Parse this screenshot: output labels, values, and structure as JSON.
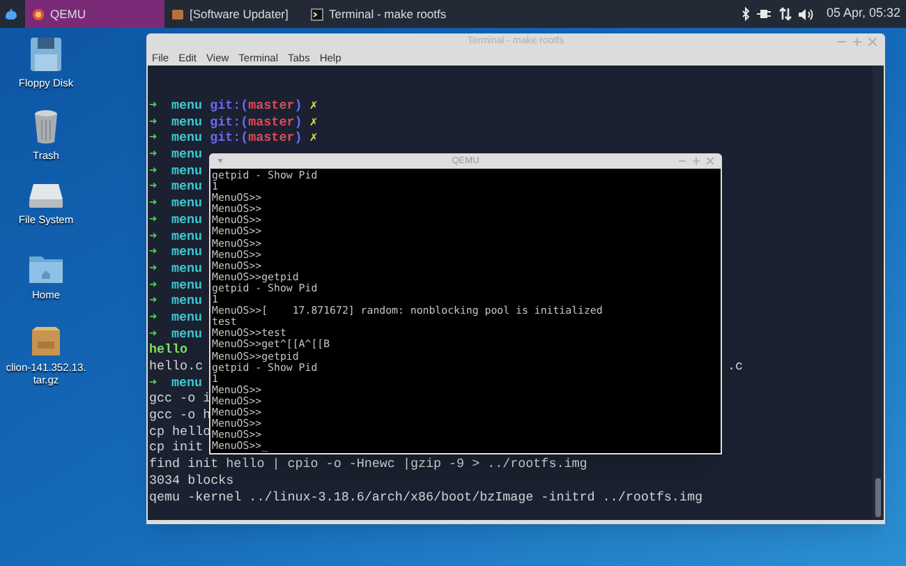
{
  "top_panel": {
    "tasks": [
      {
        "label": "QEMU",
        "kind": "qemu",
        "selected": true
      },
      {
        "label": "[Software Updater]",
        "kind": "updater",
        "selected": false
      },
      {
        "label": "Terminal - make rootfs",
        "kind": "terminal",
        "selected": false
      }
    ],
    "clock": "05 Apr, 05:32"
  },
  "desktop_icons": [
    {
      "label": "Floppy Disk",
      "kind": "floppy"
    },
    {
      "label": "Trash",
      "kind": "trash"
    },
    {
      "label": "File System",
      "kind": "drive"
    },
    {
      "label": "Home",
      "kind": "folder"
    },
    {
      "label": "clion-141.352.13.tar.gz",
      "kind": "archive"
    }
  ],
  "terminal_window": {
    "title": "Terminal - make rootfs",
    "menu": [
      "File",
      "Edit",
      "View",
      "Terminal",
      "Tabs",
      "Help"
    ],
    "lines": [
      {
        "kind": "prompt",
        "arrow": "➜",
        "dir": "menu",
        "git": "git:(",
        "branch": "master",
        "git_end": ")",
        "dirty": "✗"
      },
      {
        "kind": "prompt",
        "arrow": "➜",
        "dir": "menu",
        "git": "git:(",
        "branch": "master",
        "git_end": ")",
        "dirty": "✗"
      },
      {
        "kind": "prompt",
        "arrow": "➜",
        "dir": "menu",
        "git": "git:(",
        "branch": "master",
        "git_end": ")",
        "dirty": "✗"
      },
      {
        "kind": "prompt",
        "arrow": "➜",
        "dir": "menu"
      },
      {
        "kind": "prompt",
        "arrow": "➜",
        "dir": "menu"
      },
      {
        "kind": "prompt",
        "arrow": "➜",
        "dir": "menu"
      },
      {
        "kind": "prompt",
        "arrow": "➜",
        "dir": "menu"
      },
      {
        "kind": "prompt",
        "arrow": "➜",
        "dir": "menu"
      },
      {
        "kind": "prompt",
        "arrow": "➜",
        "dir": "menu"
      },
      {
        "kind": "prompt",
        "arrow": "➜",
        "dir": "menu"
      },
      {
        "kind": "prompt",
        "arrow": "➜",
        "dir": "menu"
      },
      {
        "kind": "prompt",
        "arrow": "➜",
        "dir": "menu"
      },
      {
        "kind": "prompt",
        "arrow": "➜",
        "dir": "menu"
      },
      {
        "kind": "prompt",
        "arrow": "➜",
        "dir": "menu"
      },
      {
        "kind": "prompt",
        "arrow": "➜",
        "dir": "menu"
      },
      {
        "kind": "executable",
        "text": "hello"
      },
      {
        "kind": "output",
        "text": "hello.c",
        "fragment": ".c"
      },
      {
        "kind": "prompt",
        "arrow": "➜",
        "dir": "menu"
      },
      {
        "kind": "output",
        "text": "gcc -o i"
      },
      {
        "kind": "output",
        "text": "gcc -o h"
      },
      {
        "kind": "output",
        "text": "cp hello"
      },
      {
        "kind": "output",
        "text": "cp init"
      },
      {
        "kind": "output",
        "text": "find init hello | cpio -o -Hnewc |gzip -9 > ../rootfs.img"
      },
      {
        "kind": "output",
        "text": "3034 blocks"
      },
      {
        "kind": "output",
        "text": "qemu -kernel ../linux-3.18.6/arch/x86/boot/bzImage -initrd ../rootfs.img"
      }
    ]
  },
  "qemu_window": {
    "title": "QEMU",
    "lines": [
      "getpid - Show Pid",
      "1",
      "MenuOS>>",
      "MenuOS>>",
      "MenuOS>>",
      "MenuOS>>",
      "MenuOS>>",
      "MenuOS>>",
      "MenuOS>>",
      "MenuOS>>getpid",
      "getpid - Show Pid",
      "1",
      "MenuOS>>[    17.871672] random: nonblocking pool is initialized",
      "test",
      "MenuOS>>test",
      "MenuOS>>get^[[A^[[B",
      "MenuOS>>getpid",
      "getpid - Show Pid",
      "1",
      "MenuOS>>",
      "MenuOS>>",
      "MenuOS>>",
      "MenuOS>>",
      "MenuOS>>",
      "MenuOS>>_"
    ]
  }
}
